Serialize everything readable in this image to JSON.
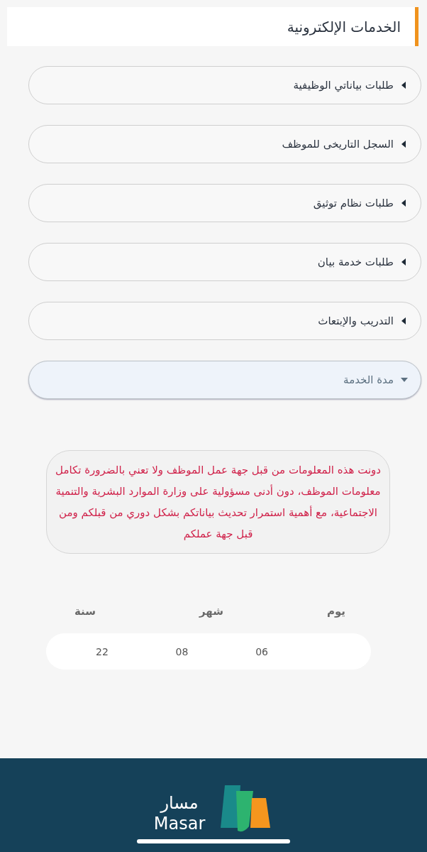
{
  "header": {
    "title": "الخدمات الإلكترونية"
  },
  "sections": [
    {
      "label": "طلبات بياناتي الوظيفية",
      "expanded": false
    },
    {
      "label": "السجل التاريخى للموظف",
      "expanded": false
    },
    {
      "label": "طلبات نظام توثيق",
      "expanded": false
    },
    {
      "label": "طلبات خدمة بيان",
      "expanded": false
    },
    {
      "label": "التدريب والإبتعاث",
      "expanded": false
    },
    {
      "label": "مدة الخدمة",
      "expanded": true
    }
  ],
  "notice": "دونت هذه المعلومات من قبل جهة عمل الموظف ولا تعني بالضرورة تكامل معلومات الموظف، دون أدنى مسؤولية على وزارة الموارد البشرية والتنمية الاجتماعية، مع أهمية استمرار تحديث بياناتكم بشكل دوري من قبلكم ومن قبل جهة عملكم",
  "duration": [
    {
      "label": "يوم",
      "value": "06"
    },
    {
      "label": "شهر",
      "value": "08"
    },
    {
      "label": "سنة",
      "value": "22"
    }
  ],
  "footer": {
    "logo_arabic": "مسار",
    "logo_latin": "Masar"
  }
}
